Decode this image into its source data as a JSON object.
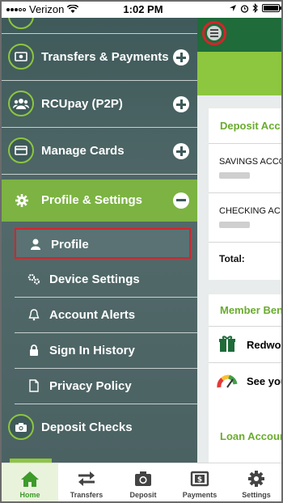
{
  "status_bar": {
    "carrier": "Verizon",
    "time": "1:02 PM"
  },
  "drawer": {
    "items": [
      {
        "label": "Transfers & Payments",
        "icon": "money-icon",
        "expand": "plus"
      },
      {
        "label": "RCUpay (P2P)",
        "icon": "people-icon",
        "expand": "plus"
      },
      {
        "label": "Manage Cards",
        "icon": "credit-card-icon",
        "expand": "plus"
      }
    ],
    "section": {
      "label": "Profile & Settings",
      "icon": "gear-icon",
      "expand": "minus"
    },
    "sub_items": [
      {
        "label": "Profile",
        "icon": "user-icon",
        "highlighted": true
      },
      {
        "label": "Device Settings",
        "icon": "gears-icon"
      },
      {
        "label": "Account Alerts",
        "icon": "bell-icon"
      },
      {
        "label": "Sign In History",
        "icon": "lock-icon"
      },
      {
        "label": "Privacy Policy",
        "icon": "document-icon"
      }
    ],
    "bottom_item": {
      "label": "Deposit Checks",
      "icon": "camera-icon"
    }
  },
  "background": {
    "deposit_title": "Deposit Acc",
    "savings": "SAVINGS ACCO",
    "checking": "CHECKING AC",
    "total": "Total:",
    "member_title": "Member Ben",
    "gift_text": "Redwoo",
    "gauge_text": "See you",
    "loan_title": "Loan Accoun"
  },
  "tabbar": {
    "tabs": [
      {
        "label": "Home",
        "icon": "home-icon",
        "active": true
      },
      {
        "label": "Transfers",
        "icon": "transfer-arrows-icon"
      },
      {
        "label": "Deposit",
        "icon": "camera-icon"
      },
      {
        "label": "Payments",
        "icon": "payment-icon"
      },
      {
        "label": "Settings",
        "icon": "gear-icon"
      }
    ]
  },
  "colors": {
    "brand_green": "#8dc63f",
    "dark_green": "#1f6b3a",
    "drawer_bg": "#4b6263",
    "highlight_red": "#d8232a"
  }
}
